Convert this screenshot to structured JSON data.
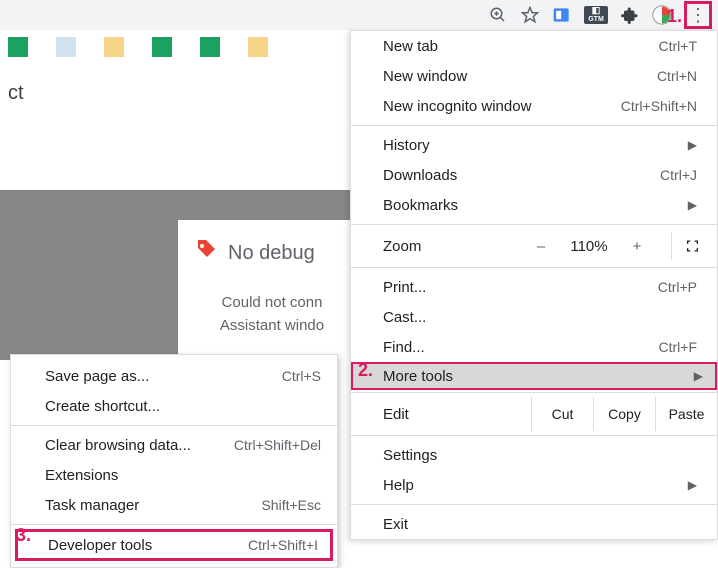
{
  "annotations": {
    "one": "1.",
    "two": "2.",
    "three": "3."
  },
  "toolbar": {
    "zoom_icon": "zoom-icon",
    "star_icon": "star-icon",
    "ext1_badge": "GTM",
    "kebab": "⋮"
  },
  "background": {
    "partial_text": "ct",
    "card_title": "No debug",
    "card_line1": "Could not conn",
    "card_line2": "Assistant windo"
  },
  "menu": {
    "new_tab": "New tab",
    "new_tab_sc": "Ctrl+T",
    "new_window": "New window",
    "new_window_sc": "Ctrl+N",
    "new_incognito": "New incognito window",
    "new_incognito_sc": "Ctrl+Shift+N",
    "history": "History",
    "downloads": "Downloads",
    "downloads_sc": "Ctrl+J",
    "bookmarks": "Bookmarks",
    "zoom_label": "Zoom",
    "zoom_minus": "–",
    "zoom_value": "110%",
    "zoom_plus": "+",
    "print": "Print...",
    "print_sc": "Ctrl+P",
    "cast": "Cast...",
    "find": "Find...",
    "find_sc": "Ctrl+F",
    "more_tools": "More tools",
    "edit": "Edit",
    "cut": "Cut",
    "copy": "Copy",
    "paste": "Paste",
    "settings": "Settings",
    "help": "Help",
    "exit": "Exit"
  },
  "submenu": {
    "save_page": "Save page as...",
    "save_page_sc": "Ctrl+S",
    "create_shortcut": "Create shortcut...",
    "clear_browsing": "Clear browsing data...",
    "clear_browsing_sc": "Ctrl+Shift+Del",
    "extensions": "Extensions",
    "task_manager": "Task manager",
    "task_manager_sc": "Shift+Esc",
    "dev_tools": "Developer tools",
    "dev_tools_sc": "Ctrl+Shift+I"
  },
  "colors": {
    "accent": "#d81b60"
  }
}
